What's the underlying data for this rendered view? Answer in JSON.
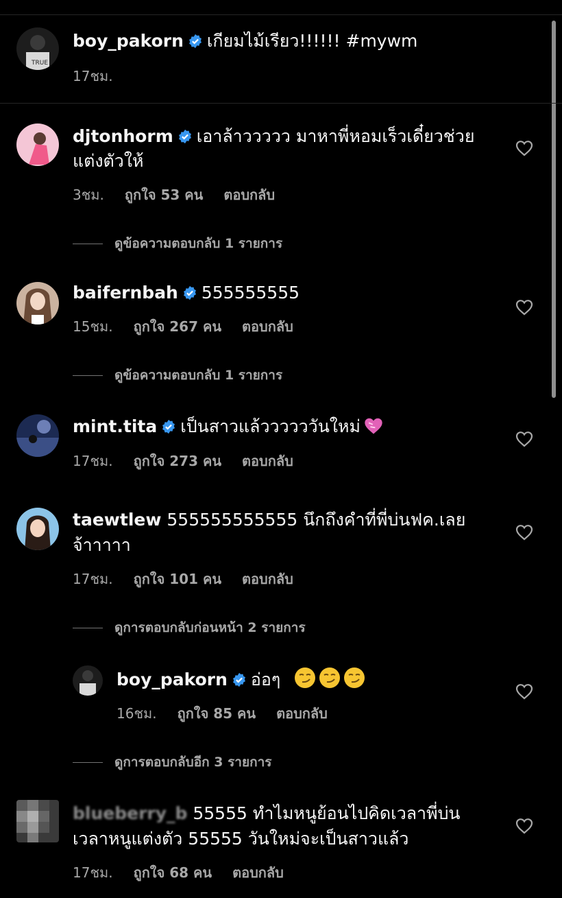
{
  "caption": {
    "username": "boy_pakorn",
    "text": "เกียมไม้เรียว!!!!!! #mywm",
    "time": "17ชม."
  },
  "comments": [
    {
      "username": "djtonhorm",
      "line1": "เอาล้าววววว มาหาพี่หอมเร็วเดี๋ยวช่วย",
      "line2": "แต่งตัวให้",
      "time": "3ชม.",
      "likes": "ถูกใจ 53 คน",
      "reply": "ตอบกลับ",
      "view": "ดูข้อความตอบกลับ 1 รายการ"
    },
    {
      "username": "baifernbah",
      "line1": "555555555",
      "time": "15ชม.",
      "likes": "ถูกใจ 267 คน",
      "reply": "ตอบกลับ",
      "view": "ดูข้อความตอบกลับ 1 รายการ"
    },
    {
      "username": "mint.tita",
      "line1": "เป็นสาวแล้ววววววันใหม่",
      "time": "17ชม.",
      "likes": "ถูกใจ 273 คน",
      "reply": "ตอบกลับ"
    },
    {
      "username": "taewtlew",
      "line1": "555555555555 นึกถึงคำที่พี่บ่นฟค.เลย",
      "line2": "จ้าาาาา",
      "time": "17ชม.",
      "likes": "ถูกใจ 101 คน",
      "reply": "ตอบกลับ",
      "view": "ดูการตอบกลับก่อนหน้า 2 รายการ"
    },
    {
      "username": "boy_pakorn",
      "line1": "อ่อๆ",
      "time": "16ชม.",
      "likes": "ถูกใจ 85 คน",
      "reply": "ตอบกลับ",
      "view": "ดูการตอบกลับอีก 3 รายการ"
    },
    {
      "username": "blueberry_b",
      "line1": "55555 ทำไมหนูย้อนไปคิดเวลาพี่บ่น",
      "line2": "เวลาหนูแต่งตัว 55555 วันใหม่จะเป็นสาวแล้ว",
      "time": "17ชม.",
      "likes": "ถูกใจ 68 คน",
      "reply": "ตอบกลับ"
    }
  ],
  "colors": {
    "background": "#000000",
    "text": "#f5f5f5",
    "secondary": "#a8a8a8",
    "verified": "#3897f0"
  },
  "icons": [
    "verified-badge-icon",
    "heart-icon",
    "purple-heart-emoji",
    "smirk-emoji"
  ]
}
